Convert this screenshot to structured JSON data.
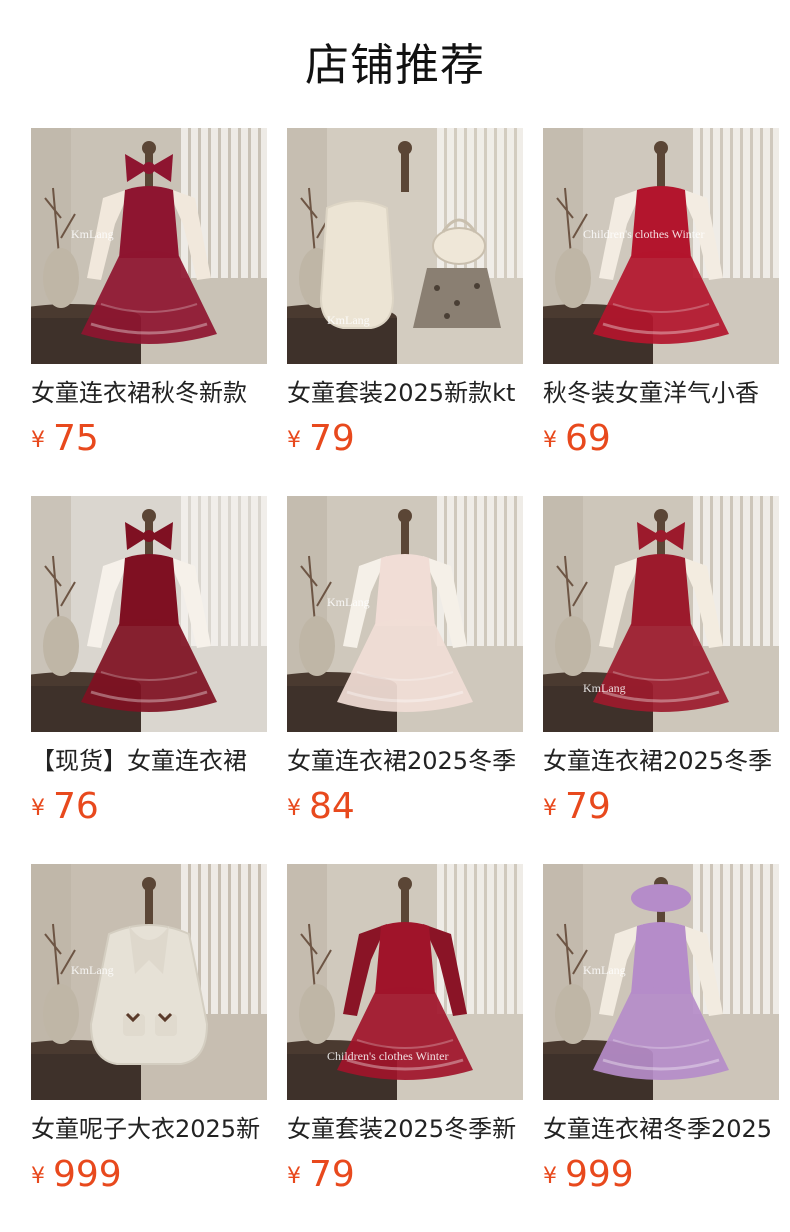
{
  "header": {
    "title": "店铺推荐"
  },
  "currency": "¥",
  "products": [
    {
      "title": "女童连衣裙秋冬新款",
      "price": "75",
      "image": "burgundy tiered tulle dress with bow",
      "dress": "#8e1530",
      "sleeve": "#f1e8dc",
      "bg": "#c9c2b6",
      "watermark": "KmLang"
    },
    {
      "title": "女童套装2025新款kt",
      "price": "79",
      "image": "cream fleece vest with leopard skirt",
      "dress": "#ece4d4",
      "sleeve": "#f4efe5",
      "bg": "#d3ccc0",
      "watermark": "KmLang"
    },
    {
      "title": "秋冬装女童洋气小香",
      "price": "69",
      "image": "red velvet dress with white feather trim",
      "dress": "#b3152d",
      "sleeve": "#f3ece2",
      "bg": "#cfc8bd",
      "watermark": "Children's clothes Winter"
    },
    {
      "title": "【现货】女童连衣裙",
      "price": "76",
      "image": "burgundy sequin dress with red tulle hem",
      "dress": "#7f1022",
      "sleeve": "#f6f1ea",
      "bg": "#dad6cf",
      "watermark": ""
    },
    {
      "title": "女童连衣裙2025冬季",
      "price": "84",
      "image": "rainbow tulle dress with cream top",
      "dress": "#f1ddd6",
      "sleeve": "#f5f0e8",
      "bg": "#cfc8bc",
      "watermark": "KmLang"
    },
    {
      "title": "女童连衣裙2025冬季",
      "price": "79",
      "image": "red ruffled tulle dress with bow headband",
      "dress": "#9c1a2c",
      "sleeve": "#f3ece0",
      "bg": "#cdc6ba",
      "watermark": "KmLang"
    },
    {
      "title": "女童呢子大衣2025新",
      "price": "999",
      "image": "cream wool coat with scarf and bows",
      "dress": "#e6e1d6",
      "sleeve": "#ebe6db",
      "bg": "#c7beb1",
      "watermark": "KmLang"
    },
    {
      "title": "女童套装2025冬季新",
      "price": "79",
      "image": "red tweed vest with tulle skirt and long sleeves",
      "dress": "#a0142a",
      "sleeve": "#8a1426",
      "bg": "#d0c9bd",
      "watermark": "Children's clothes Winter"
    },
    {
      "title": "女童连衣裙冬季2025",
      "price": "999",
      "image": "lavender fluffy dress with beret",
      "dress": "#b58cc9",
      "sleeve": "#f2ebe0",
      "bg": "#cdc5b9",
      "watermark": "KmLang"
    }
  ]
}
